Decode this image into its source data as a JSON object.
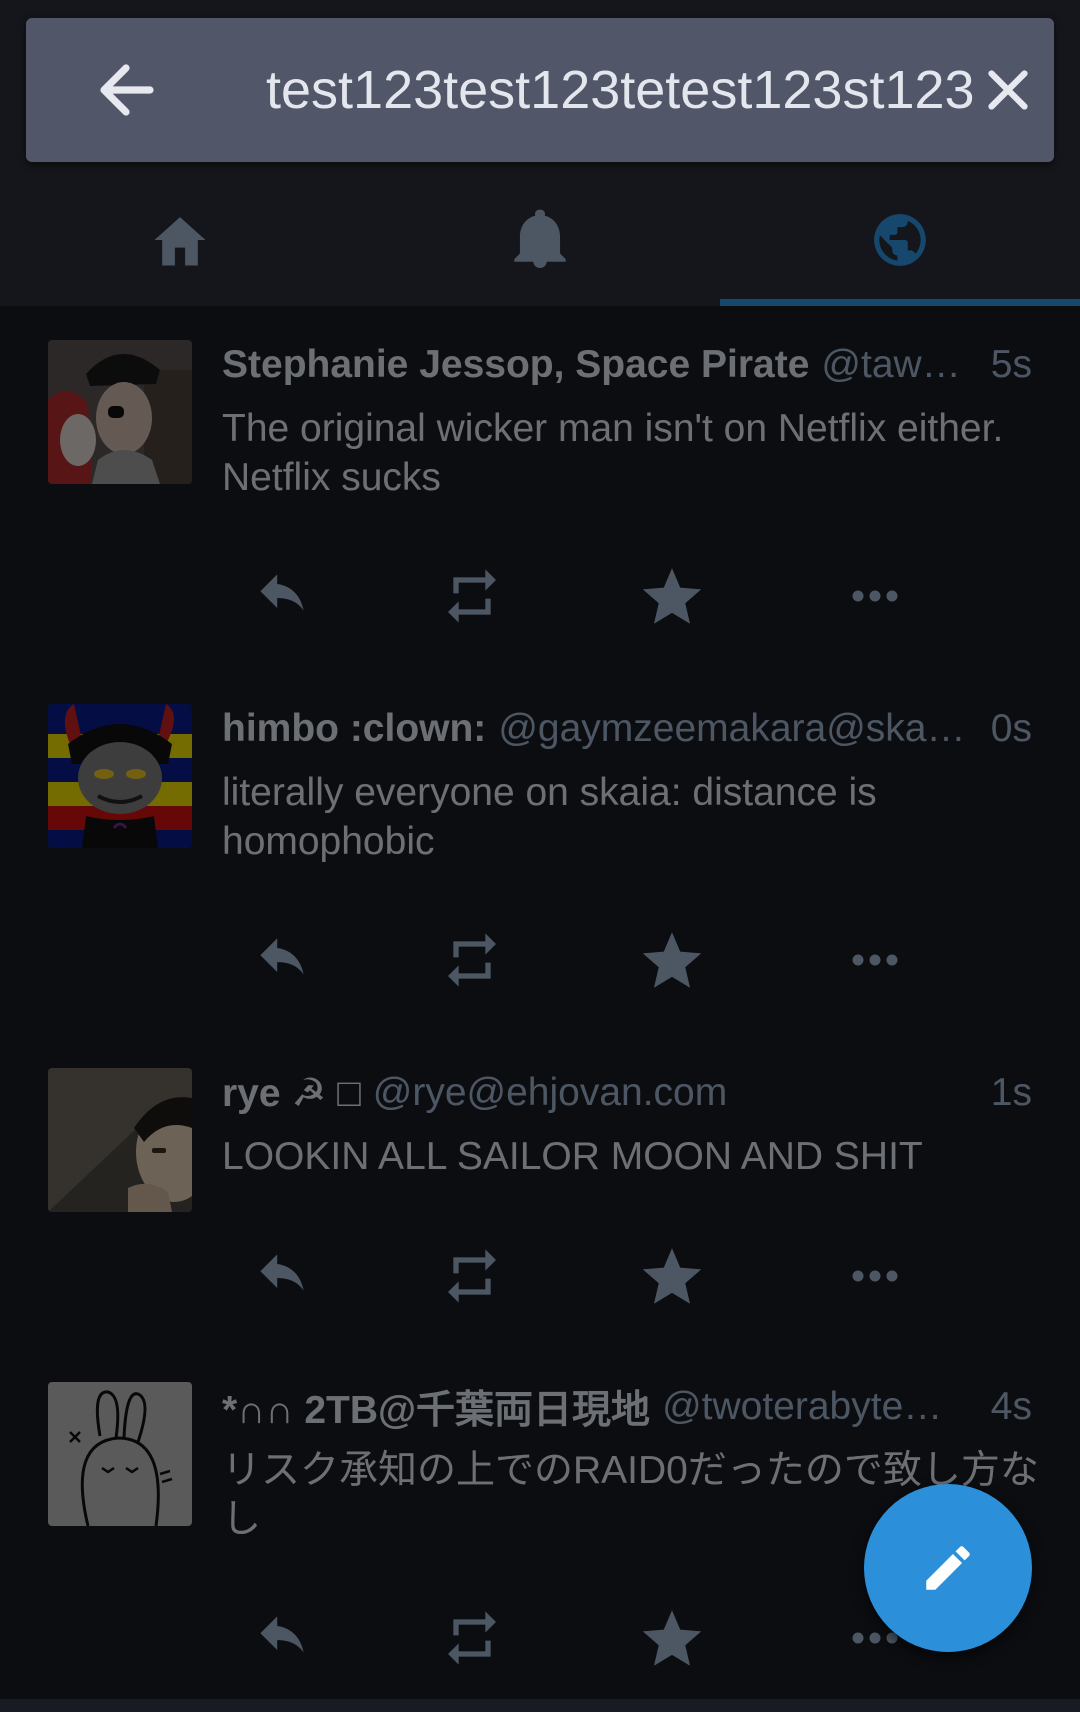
{
  "search": {
    "value": "test123test123tetest123st123",
    "back_icon": "arrow-left-icon",
    "clear_icon": "close-icon"
  },
  "tabs": [
    {
      "icon": "home-icon",
      "active": false
    },
    {
      "icon": "bell-icon",
      "active": false
    },
    {
      "icon": "globe-icon",
      "active": true
    }
  ],
  "statuses": [
    {
      "name": "Stephanie Jessop, Space Pirate",
      "handle": "@taw…",
      "time": "5s",
      "content": "The original wicker man isn't on Netflix either. Netflix sucks"
    },
    {
      "name": "himbo :clown:",
      "handle": "@gaymzeemakara@ska…",
      "time": "0s",
      "content": "literally everyone on skaia: distance is homophobic"
    },
    {
      "name": "rye ☭ □",
      "handle": "@rye@ehjovan.com",
      "time": "1s",
      "content": "LOOKIN ALL SAILOR MOON AND SHIT"
    },
    {
      "name": "*∩∩ 2TB@千葉両日現地",
      "handle": "@twoterabyte…",
      "time": "4s",
      "content": "リスク承知の上でのRAID0だったので致し方なし"
    }
  ],
  "fab_icon": "pencil-icon",
  "colors": {
    "accent": "#2b90d9",
    "background": "#191b22",
    "tabbar": "#282c37",
    "search_bar": "#515669"
  }
}
